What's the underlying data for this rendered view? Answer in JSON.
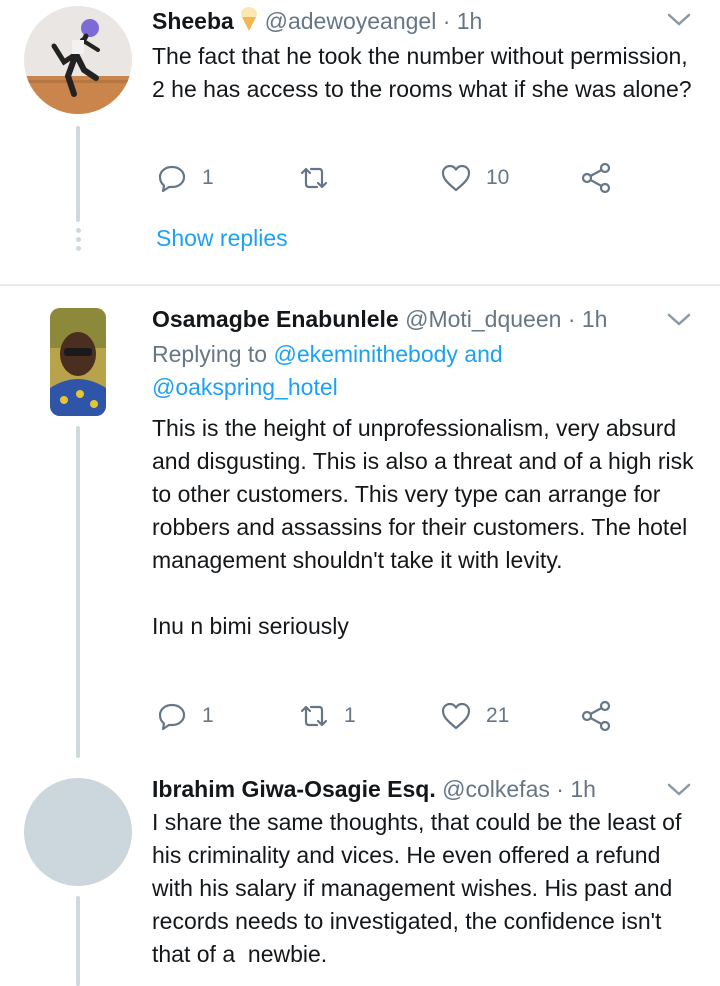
{
  "tweets": [
    {
      "name": "Sheeba",
      "handle": "@adewoyeangel",
      "time": "1h",
      "reply_prefix": "",
      "reply_users": "",
      "reply_users2": "",
      "text": "The fact that he took the number without permission, 2 he has access to the rooms what if she was alone?",
      "replies": "1",
      "retweets": "",
      "likes": "10",
      "show_replies": "Show replies"
    },
    {
      "name": "Osamagbe  Enabunlele",
      "handle": "@Moti_dqueen",
      "time": "1h",
      "reply_prefix": "Replying to",
      "reply_users": "@ekeminithebody and",
      "reply_users2": "@oakspring_hotel",
      "text": "This is the height of unprofessionalism, very absurd and disgusting. This is also a threat and of a high risk to other customers. This very type can arrange for robbers and assassins for their customers. The hotel management shouldn't take it with levity.\n\nInu n bimi seriously",
      "replies": "1",
      "retweets": "1",
      "likes": "21"
    },
    {
      "name": "Ibrahim Giwa-Osagie Esq.",
      "handle": "@colkefas",
      "time": "1h",
      "text": "I share the same thoughts, that could be the least of his criminality and vices. He even offered a refund with his salary if management wishes. His past and records needs to investigated, the confidence isn't that of a  newbie."
    }
  ],
  "separator": "·",
  "icons": {
    "reply": "reply-icon",
    "retweet": "retweet-icon",
    "like": "heart-icon",
    "share": "share-icon",
    "more": "chevron-down-icon",
    "name_emoji": "ice-cream-icon"
  },
  "colors": {
    "link": "#1da1f2",
    "secondary": "#657786",
    "primary": "#14171a",
    "divider": "#e6ecf0"
  }
}
